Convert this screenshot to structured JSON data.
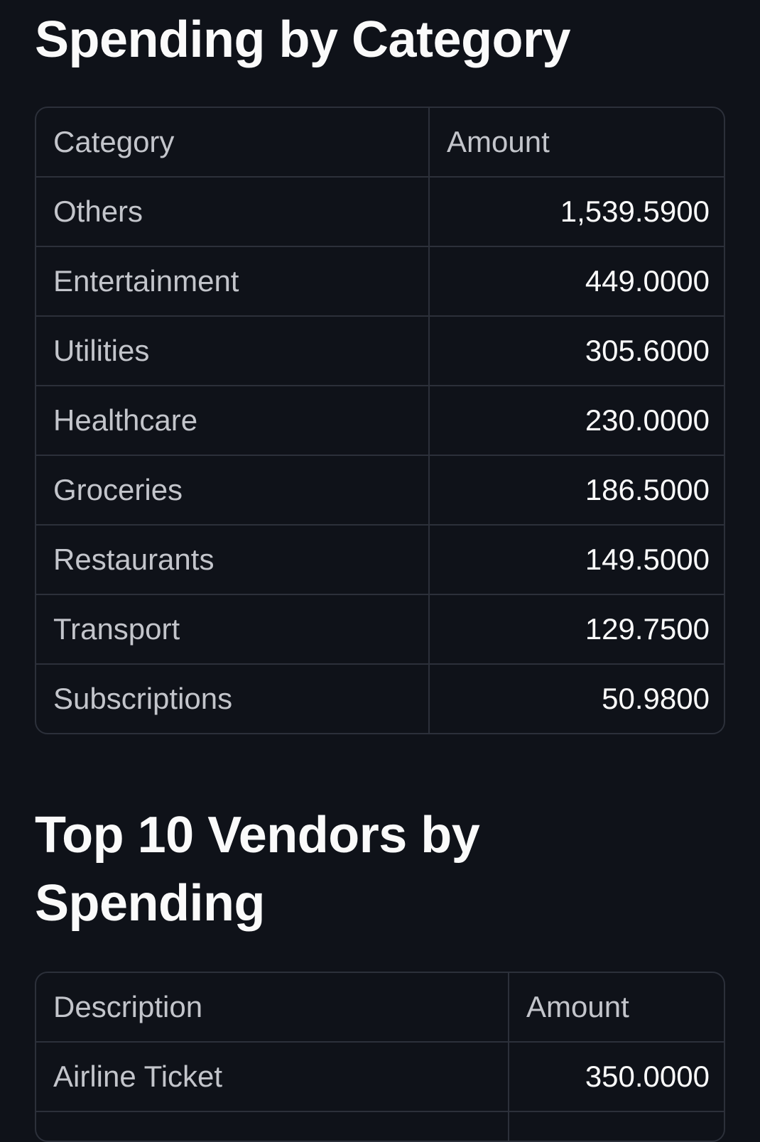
{
  "spending_by_category": {
    "title": "Spending by Category",
    "columns": [
      "Category",
      "Amount"
    ],
    "rows": [
      {
        "category": "Others",
        "amount": "1,539.5900"
      },
      {
        "category": "Entertainment",
        "amount": "449.0000"
      },
      {
        "category": "Utilities",
        "amount": "305.6000"
      },
      {
        "category": "Healthcare",
        "amount": "230.0000"
      },
      {
        "category": "Groceries",
        "amount": "186.5000"
      },
      {
        "category": "Restaurants",
        "amount": "149.5000"
      },
      {
        "category": "Transport",
        "amount": "129.7500"
      },
      {
        "category": "Subscriptions",
        "amount": "50.9800"
      }
    ]
  },
  "top_vendors": {
    "title": "Top 10 Vendors by Spending",
    "columns": [
      "Description",
      "Amount"
    ],
    "rows": [
      {
        "description": "Airline Ticket",
        "amount": "350.0000"
      }
    ]
  }
}
